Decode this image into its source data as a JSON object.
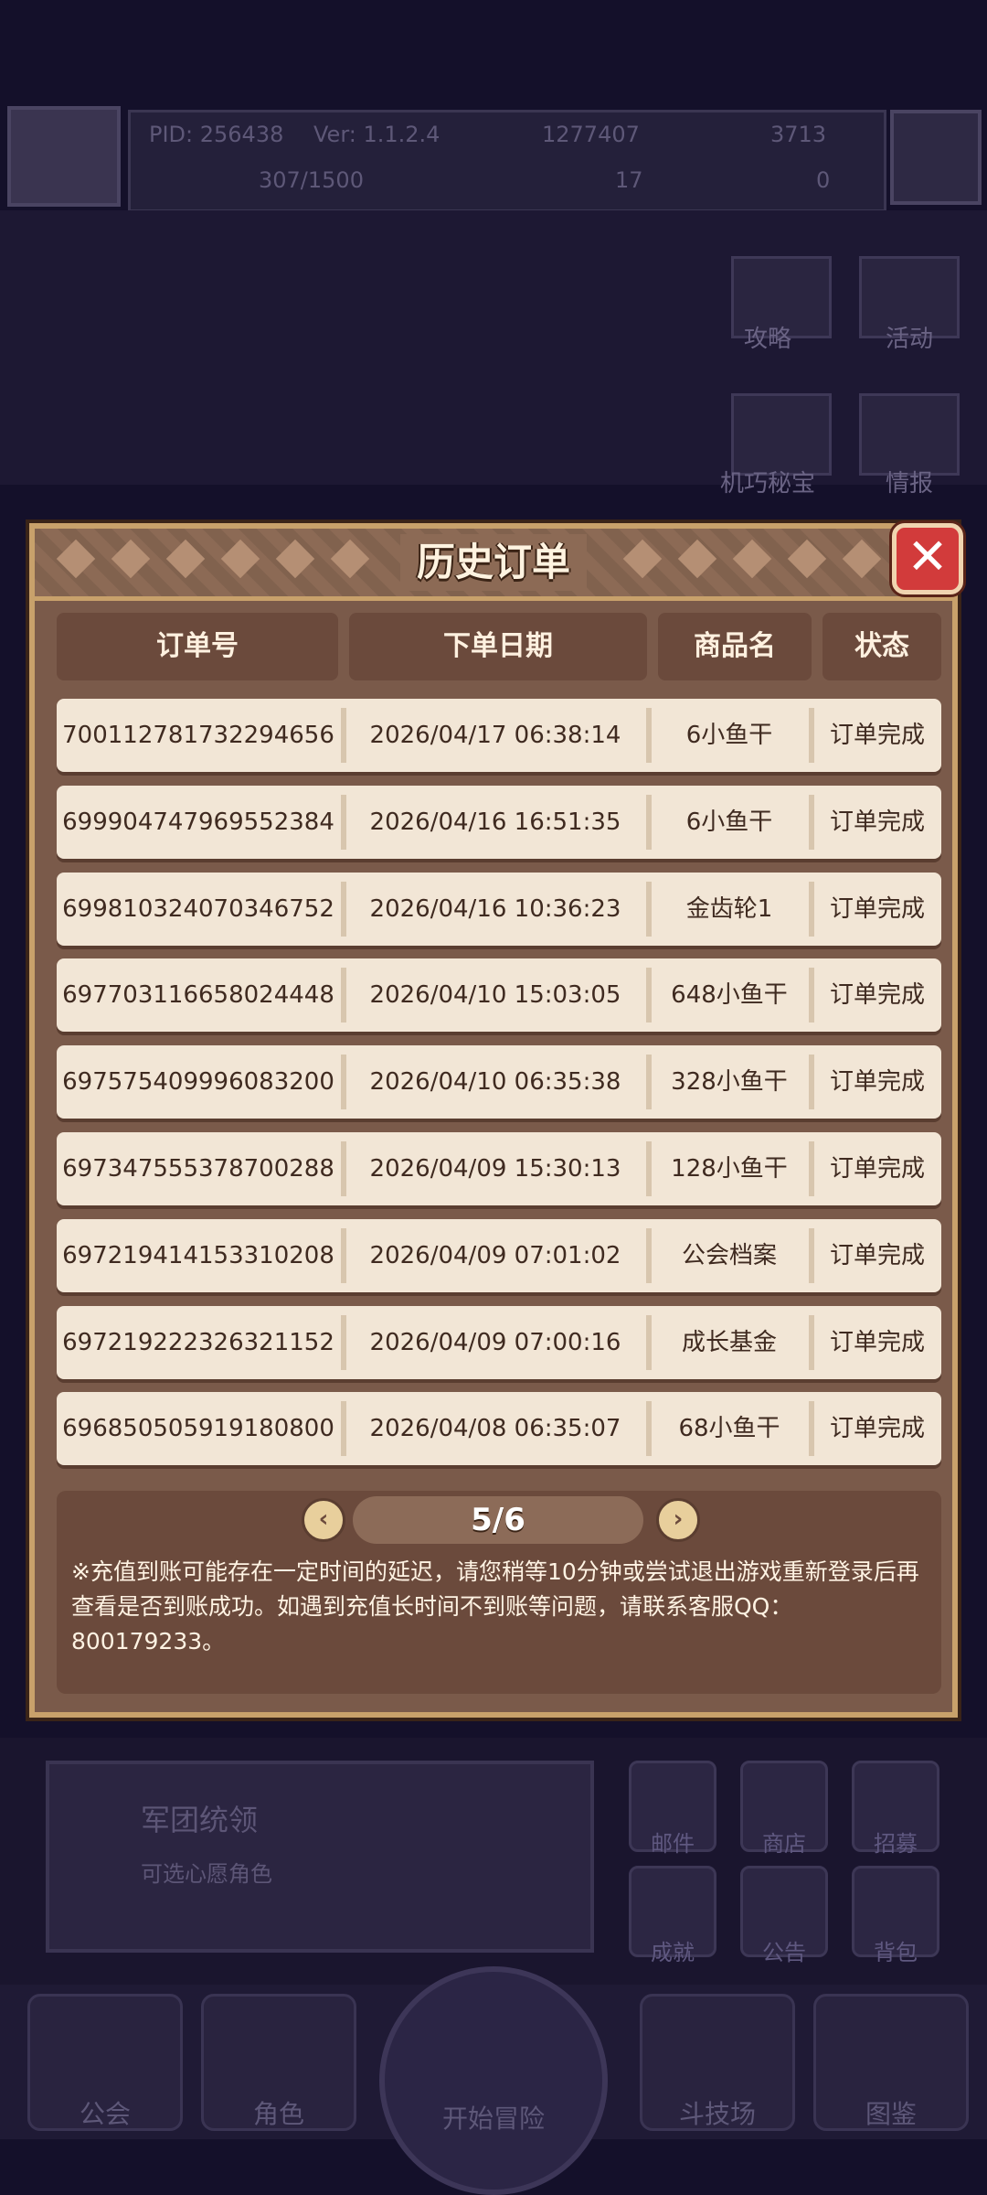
{
  "background": {
    "pid": "PID: 256438",
    "version": "Ver: 1.1.2.4",
    "coins": "1277407",
    "gems": "3713",
    "energy": "307/1500",
    "keys": "17",
    "tickets": "0",
    "side_buttons": [
      "攻略",
      "活动",
      "机巧秘宝",
      "情报"
    ],
    "legion_title": "军团统领",
    "legion_sub": "可选心愿角色",
    "menu_buttons": [
      "邮件",
      "商店",
      "招募",
      "成就",
      "公告",
      "背包"
    ],
    "nav": [
      "公会",
      "角色",
      "开始冒险",
      "斗技场",
      "图鉴"
    ]
  },
  "dialog": {
    "title": "历史订单",
    "close_icon": "close-icon",
    "columns": [
      "订单号",
      "下单日期",
      "商品名",
      "状态"
    ],
    "rows": [
      {
        "order_id": "700112781732294656",
        "date": "2026/04/17 06:38:14",
        "item": "6小鱼干",
        "status": "订单完成"
      },
      {
        "order_id": "699904747969552384",
        "date": "2026/04/16 16:51:35",
        "item": "6小鱼干",
        "status": "订单完成"
      },
      {
        "order_id": "699810324070346752",
        "date": "2026/04/16 10:36:23",
        "item": "金齿轮1",
        "status": "订单完成"
      },
      {
        "order_id": "697703116658024448",
        "date": "2026/04/10 15:03:05",
        "item": "648小鱼干",
        "status": "订单完成"
      },
      {
        "order_id": "697575409996083200",
        "date": "2026/04/10 06:35:38",
        "item": "328小鱼干",
        "status": "订单完成"
      },
      {
        "order_id": "697347555378700288",
        "date": "2026/04/09 15:30:13",
        "item": "128小鱼干",
        "status": "订单完成"
      },
      {
        "order_id": "697219414153310208",
        "date": "2026/04/09 07:01:02",
        "item": "公会档案",
        "status": "订单完成"
      },
      {
        "order_id": "697219222326321152",
        "date": "2026/04/09 07:00:16",
        "item": "成长基金",
        "status": "订单完成"
      },
      {
        "order_id": "696850505919180800",
        "date": "2026/04/08 06:35:07",
        "item": "68小鱼干",
        "status": "订单完成"
      }
    ],
    "pager": "5/6",
    "notice": "※充值到账可能存在一定时间的延迟，请您稍等10分钟或尝试退出游戏重新登录后再查看是否到账成功。如遇到充值长时间不到账等问题，请联系客服QQ：800179233。"
  }
}
